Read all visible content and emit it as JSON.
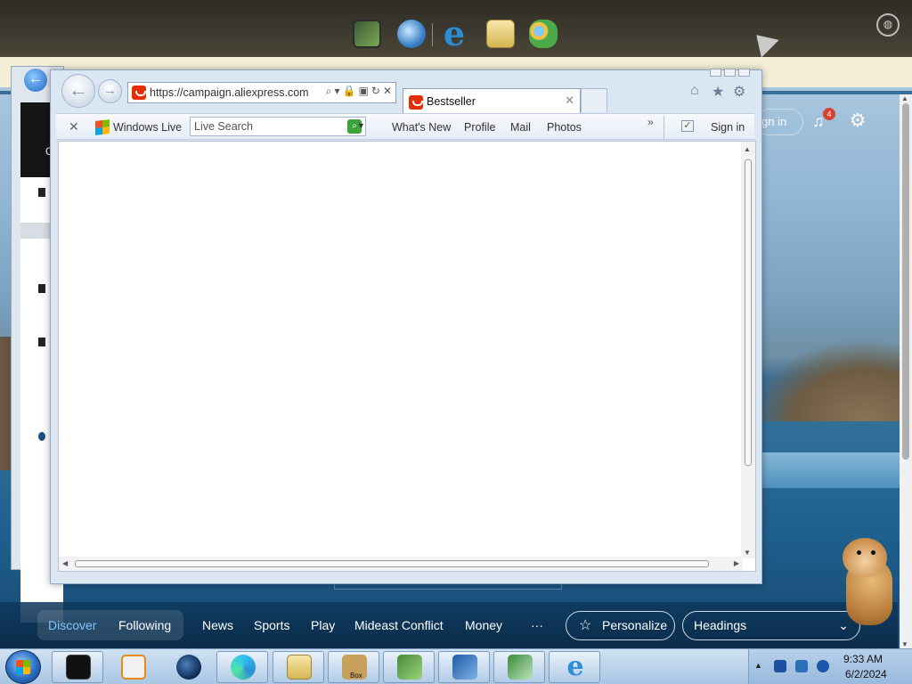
{
  "ie": {
    "address_url": "https://campaign.",
    "address_domain": "aliexpress.com",
    "tab_title": "Bestseller",
    "toolbar": {
      "windows_live": "Windows Live",
      "search_placeholder": "Live Search",
      "links": [
        "What's New",
        "Profile",
        "Mail",
        "Photos"
      ],
      "more": "»",
      "sign_in": "Sign in"
    }
  },
  "explorer": {
    "org_label": "Org"
  },
  "msn": {
    "signin_fragment": "gn in",
    "notification_count": "4",
    "tabs": [
      "Discover",
      "Following"
    ],
    "categories": [
      "News",
      "Sports",
      "Play",
      "Mideast Conflict",
      "Money"
    ],
    "more": "···",
    "personalize": "Personalize",
    "headings": "Headings"
  },
  "taskbar": {
    "time": "9:33 AM",
    "date": "6/2/2024",
    "box_label": "Box"
  },
  "icons": {
    "ie_logo": "e",
    "check": "✓",
    "close": "✕",
    "star": "☆",
    "gear": "⚙",
    "home": "⌂",
    "bell": "🔔",
    "chevron": "⌄"
  },
  "colors": {
    "accent": "#2a8fd6",
    "aliexpress": "#e62e04",
    "msn_active": "#7ec3ff",
    "badge": "#d8432e"
  }
}
